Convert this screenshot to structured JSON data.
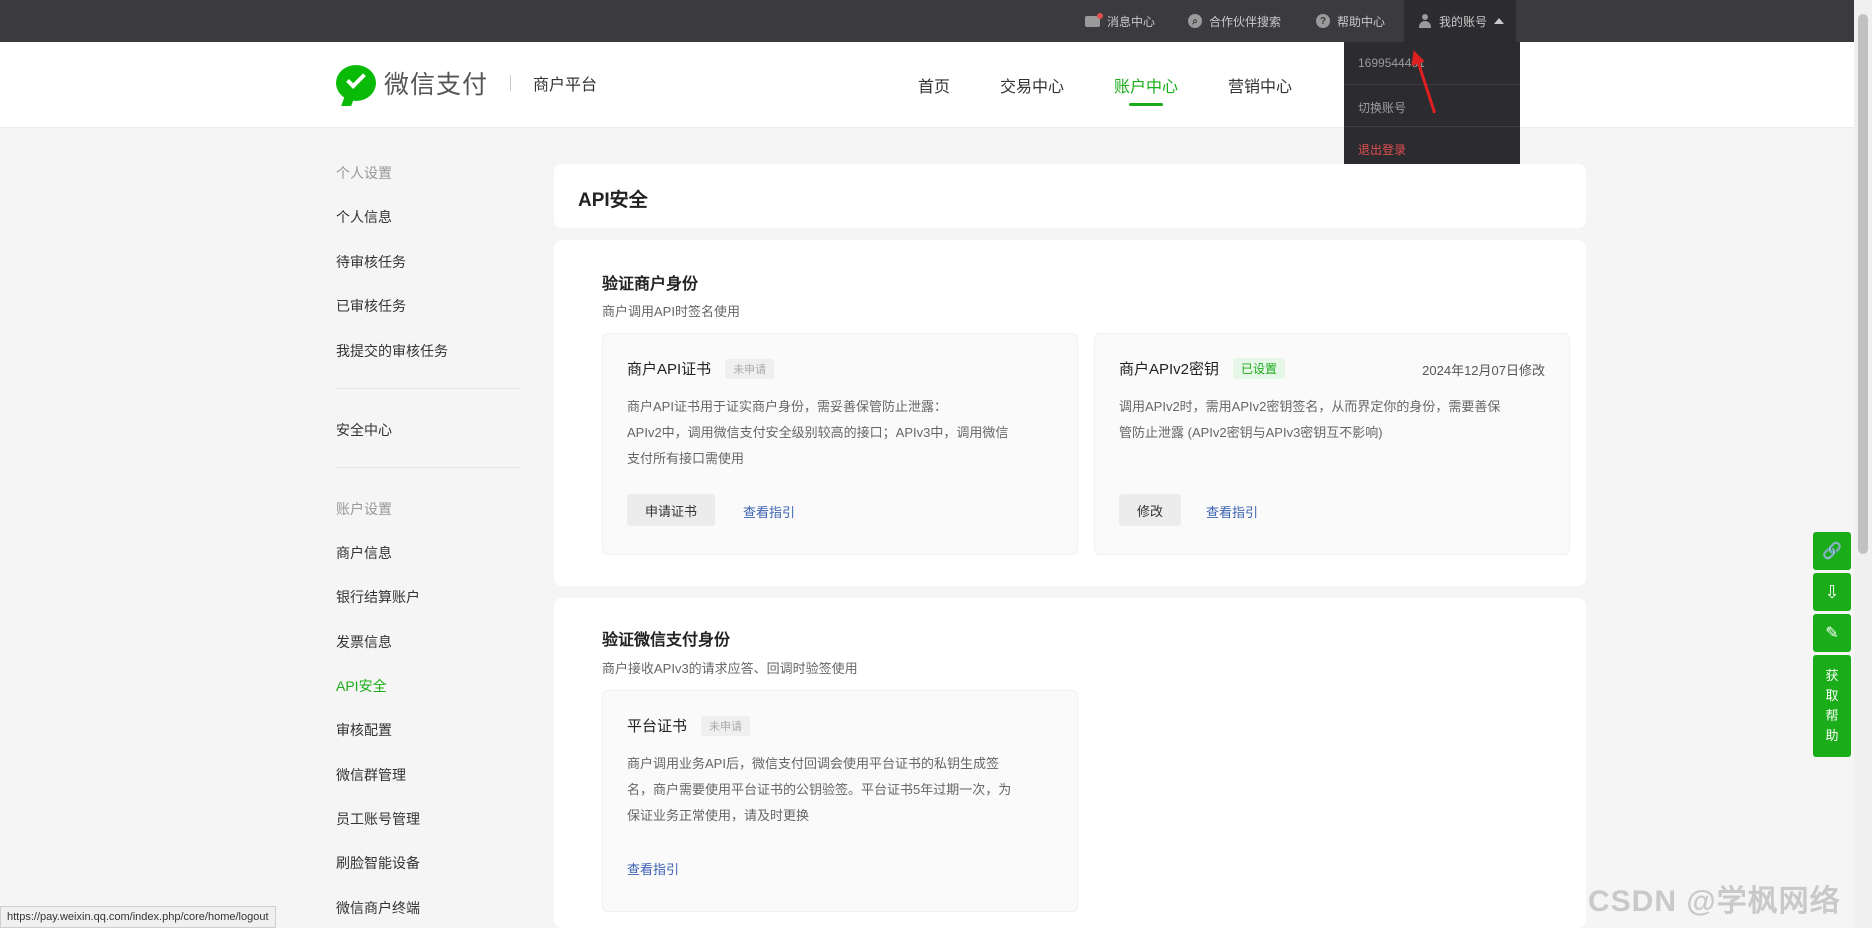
{
  "topbar": {
    "message_center": "消息中心",
    "partner_search": "合作伙伴搜索",
    "help_center": "帮助中心",
    "my_account": "我的账号"
  },
  "account_menu": {
    "account_id": "1699544461",
    "switch_account": "切换账号",
    "logout": "退出登录"
  },
  "header": {
    "brand": "微信支付",
    "platform": "商户平台",
    "nav": [
      "首页",
      "交易中心",
      "账户中心",
      "营销中心"
    ],
    "active_nav": "账户中心"
  },
  "sidebar": {
    "personal_group": "个人设置",
    "personal_items": [
      "个人信息",
      "待审核任务",
      "已审核任务",
      "我提交的审核任务"
    ],
    "security_center": "安全中心",
    "account_group": "账户设置",
    "account_items": [
      "商户信息",
      "银行结算账户",
      "发票信息",
      "API安全",
      "审核配置",
      "微信群管理",
      "员工账号管理",
      "刷脸智能设备",
      "微信商户终端"
    ],
    "active_item": "API安全"
  },
  "page": {
    "title": "API安全"
  },
  "section_merchant": {
    "title": "验证商户身份",
    "desc": "商户调用API时签名使用",
    "cert_card": {
      "name": "商户API证书",
      "status": "未申请",
      "desc_lines": [
        "商户API证书用于证实商户身份，需妥善保管防止泄露：",
        "APIv2中，调用微信支付安全级别较高的接口；APIv3中，调用微信",
        "支付所有接口需使用"
      ],
      "apply_button": "申请证书",
      "guide_link": "查看指引"
    },
    "key_card": {
      "name": "商户APIv2密钥",
      "status": "已设置",
      "modified": "2024年12月07日修改",
      "desc_lines": [
        "调用APIv2时，需用APIv2密钥签名，从而界定你的身份，需要善保",
        "管防止泄露 (APIv2密钥与APIv3密钥互不影响)"
      ],
      "modify_button": "修改",
      "guide_link": "查看指引"
    }
  },
  "section_wechat": {
    "title": "验证微信支付身份",
    "desc": "商户接收APIv3的请求应答、回调时验签使用",
    "platform_card": {
      "name": "平台证书",
      "status": "未申请",
      "desc_lines": [
        "商户调用业务API后，微信支付回调会使用平台证书的私钥生成签",
        "名，商户需要使用平台证书的公钥验签。平台证书5年过期一次，为",
        "保证业务正常使用，请及时更换"
      ],
      "guide_link": "查看指引"
    }
  },
  "tools": {
    "help_label": [
      "获",
      "取",
      "帮",
      "助"
    ]
  },
  "status_url": "https://pay.weixin.qq.com/index.php/core/home/logout",
  "watermark": "CSDN @学枫网络",
  "colors": {
    "accent": "#1aad19",
    "topbar": "#3a3a3f",
    "danger": "#e34d4d",
    "link": "#3b62b2"
  }
}
